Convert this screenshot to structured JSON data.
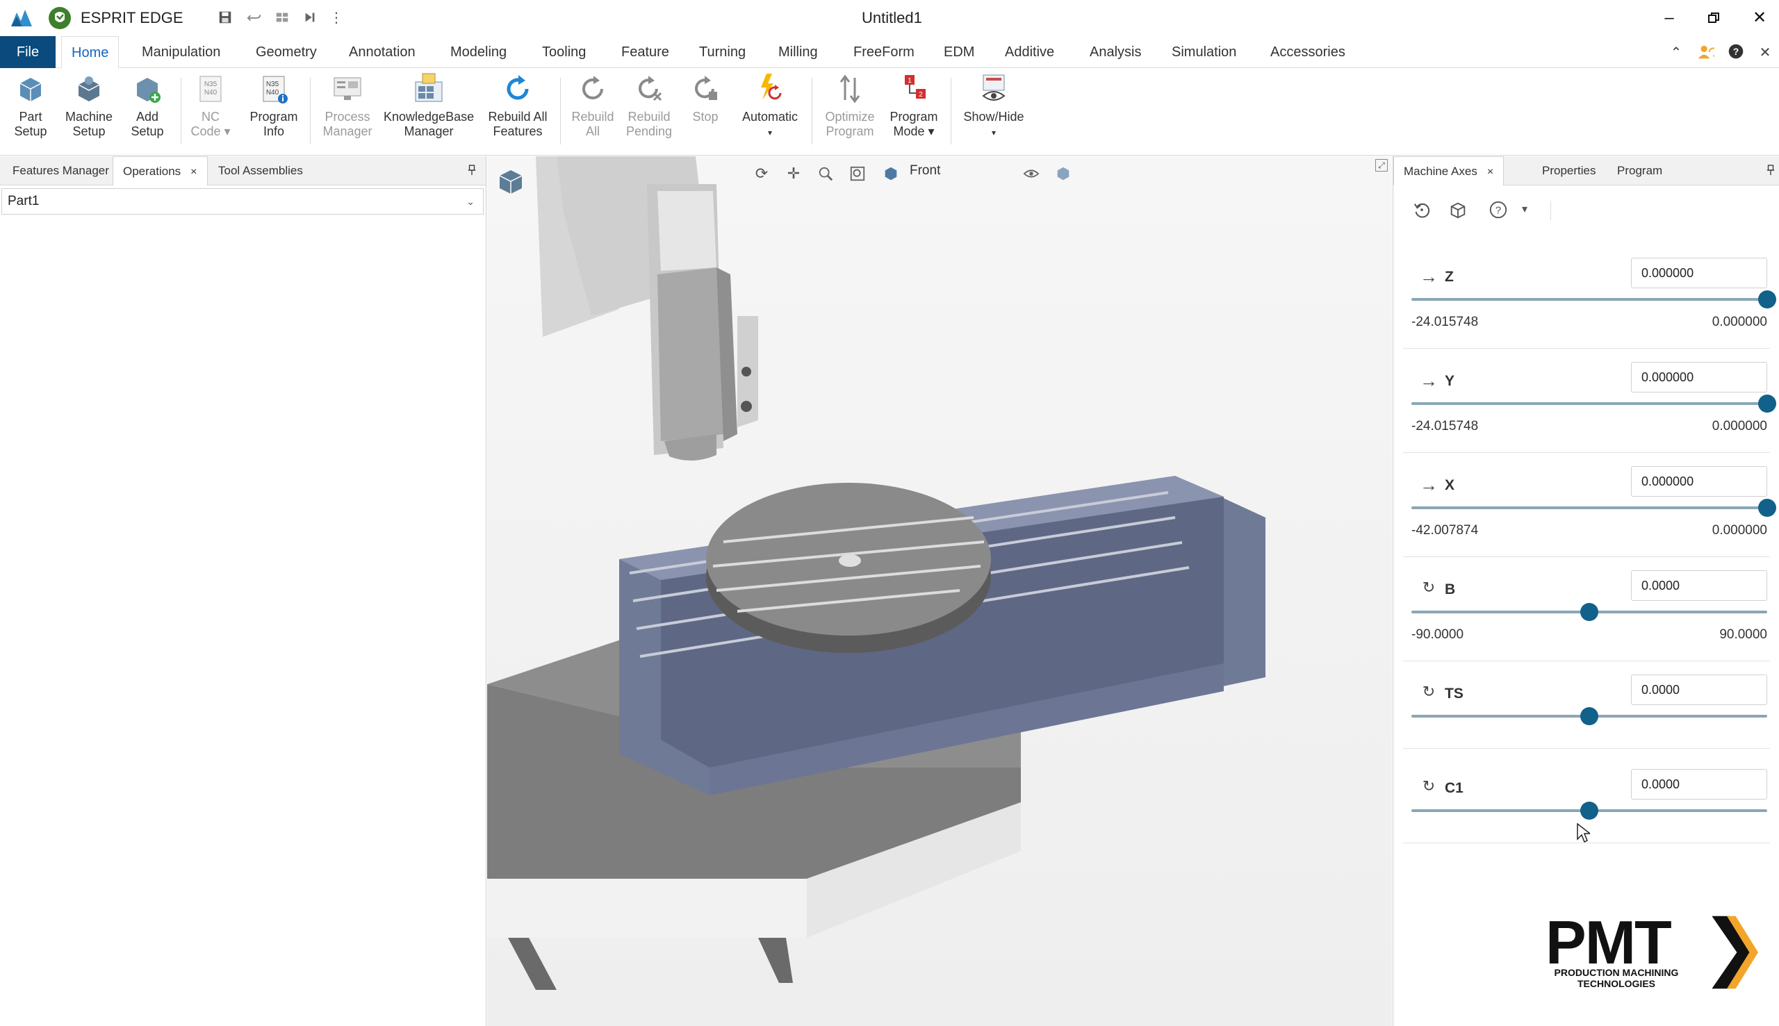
{
  "titlebar": {
    "app_name": "ESPRIT EDGE",
    "document_title": "Untitled1",
    "icons": [
      "save-icon",
      "undo-icon",
      "layout-icon",
      "step-icon",
      "more-icon"
    ],
    "window_controls": [
      "minimize-icon",
      "restore-icon",
      "close-icon"
    ]
  },
  "tabs": {
    "file": "File",
    "items": [
      "Home",
      "Manipulation",
      "Geometry",
      "Annotation",
      "Modeling",
      "Tooling",
      "Feature",
      "Turning",
      "Milling",
      "FreeForm",
      "EDM",
      "Additive",
      "Analysis",
      "Simulation",
      "Accessories"
    ],
    "active": "Home"
  },
  "ribbon": {
    "part_setup": [
      "Part",
      "Setup"
    ],
    "machine_setup": [
      "Machine",
      "Setup"
    ],
    "add_setup": [
      "Add",
      "Setup"
    ],
    "nc_code": [
      "NC",
      "Code ▾"
    ],
    "program_info": [
      "Program",
      "Info"
    ],
    "process_manager": [
      "Process",
      "Manager"
    ],
    "knowledgebase_manager": [
      "KnowledgeBase",
      "Manager"
    ],
    "rebuild_all_features": [
      "Rebuild All",
      "Features"
    ],
    "rebuild_all": [
      "Rebuild",
      "All"
    ],
    "rebuild_pending": [
      "Rebuild",
      "Pending"
    ],
    "stop": [
      "Stop",
      ""
    ],
    "automatic": [
      "Automatic",
      "▾"
    ],
    "optimize_program": [
      "Optimize",
      "Program"
    ],
    "program_mode": [
      "Program",
      "Mode ▾"
    ],
    "show_hide": [
      "Show/Hide",
      "▾"
    ],
    "nc_icon_text": [
      "N35",
      "N40"
    ]
  },
  "left_panel": {
    "tabs": [
      "Features Manager",
      "Operations",
      "Tool Assemblies"
    ],
    "active_tab": "Operations",
    "close_glyph": "×",
    "part_value": "Part1"
  },
  "viewport": {
    "view_label": "Front"
  },
  "right_panel": {
    "tabs": [
      "Machine Axes",
      "Properties",
      "Program"
    ],
    "active_tab": "Machine Axes",
    "close_glyph": "×",
    "axes": [
      {
        "name": "Z",
        "value": "0.000000",
        "min": "-24.015748",
        "max": "0.000000",
        "level": 1.0,
        "type": "linear"
      },
      {
        "name": "Y",
        "value": "0.000000",
        "min": "-24.015748",
        "max": "0.000000",
        "level": 1.0,
        "type": "linear"
      },
      {
        "name": "X",
        "value": "0.000000",
        "min": "-42.007874",
        "max": "0.000000",
        "level": 1.0,
        "type": "linear"
      },
      {
        "name": "B",
        "value": "0.0000",
        "min": "-90.0000",
        "max": "90.0000",
        "level": 0.5,
        "type": "rotary"
      },
      {
        "name": "TS",
        "value": "0.0000",
        "min": "",
        "max": "",
        "level": 0.5,
        "type": "rotary"
      },
      {
        "name": "C1",
        "value": "0.0000",
        "min": "",
        "max": "",
        "level": 0.5,
        "type": "rotary"
      }
    ]
  },
  "logo": {
    "name": "PMT",
    "line1": "PRODUCTION MACHINING",
    "line2": "TECHNOLOGIES",
    "accent": "#f2a52a"
  },
  "colors": {
    "file_tab": "#0a4a7c",
    "accent": "#1565c0",
    "slider_knob": "#11618a",
    "table_blue": "#6f7a96"
  }
}
